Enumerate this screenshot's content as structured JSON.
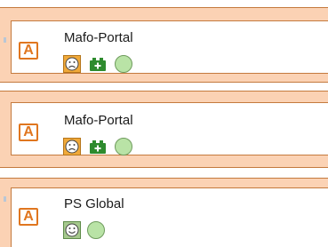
{
  "cards": [
    {
      "type_letter": "A",
      "title": "Mafo-Portal",
      "status_icons": [
        "sad-face-icon",
        "battery-icon",
        "green-circle-icon"
      ]
    },
    {
      "type_letter": "A",
      "title": "Mafo-Portal",
      "status_icons": [
        "sad-face-icon",
        "battery-icon",
        "green-circle-icon"
      ]
    },
    {
      "type_letter": "A",
      "title": "PS Global",
      "status_icons": [
        "happy-face-icon",
        "green-circle-icon"
      ]
    }
  ],
  "colors": {
    "card_frame": "#fbd2b4",
    "card_border": "#c47a3e",
    "type_icon": "#e0761f",
    "sad_face_bg": "#f0a93a",
    "happy_face_bg": "#a6c98e",
    "battery": "#2e8b2e",
    "status_circle": "#b9e3a6"
  }
}
